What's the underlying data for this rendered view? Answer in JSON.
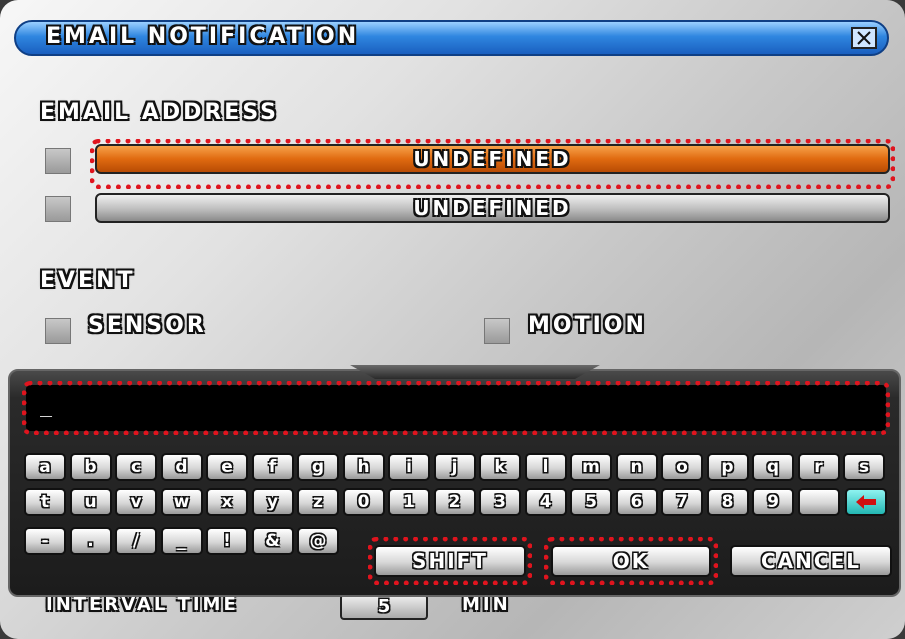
{
  "window": {
    "title": "EMAIL NOTIFICATION"
  },
  "email": {
    "section_label": "EMAIL ADDRESS",
    "addresses": [
      {
        "value": "UNDEFINED",
        "state": "focused",
        "color": "#e06a10"
      },
      {
        "value": "UNDEFINED",
        "state": "normal"
      }
    ]
  },
  "event": {
    "section_label": "EVENT",
    "items": [
      {
        "label": "SENSOR"
      },
      {
        "label": "MOTION"
      }
    ]
  },
  "interval": {
    "label": "INTERVAL TIME",
    "value": "5",
    "unit": "MIN"
  },
  "keyboard": {
    "input_value": "_",
    "row1": [
      "a",
      "b",
      "c",
      "d",
      "e",
      "f",
      "g",
      "h",
      "i",
      "j",
      "k",
      "l",
      "m",
      "n",
      "o",
      "p",
      "q",
      "r",
      "s"
    ],
    "row2": [
      "t",
      "u",
      "v",
      "w",
      "x",
      "y",
      "z",
      "0",
      "1",
      "2",
      "3",
      "4",
      "5",
      "6",
      "7",
      "8",
      "9"
    ],
    "row3": [
      "-",
      ".",
      "/",
      "_",
      "!",
      "&",
      "@"
    ],
    "enter_icon": "left-arrow-icon",
    "shift_label": "SHIFT",
    "ok_label": "OK",
    "cancel_label": "CANCEL"
  },
  "colors": {
    "title_bar": "#2f86e0",
    "focus_outline": "#e0141e",
    "enter_key": "#23b7b3"
  }
}
